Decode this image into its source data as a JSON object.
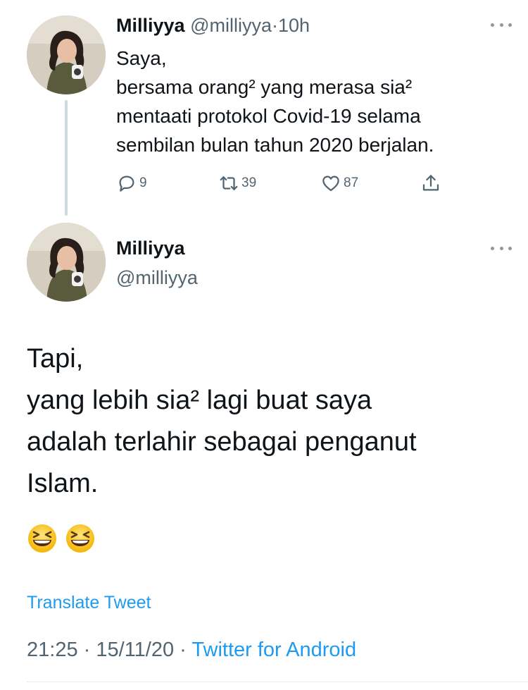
{
  "tweet1": {
    "name": "Milliyya",
    "handle": "@milliyya",
    "separator": "·",
    "time": "10h",
    "lines": [
      "Saya,",
      "bersama orang² yang merasa sia²",
      "mentaati protokol Covid-19 selama",
      "sembilan bulan tahun 2020 berjalan."
    ],
    "actions": {
      "reply_count": "9",
      "retweet_count": "39",
      "like_count": "87"
    }
  },
  "tweet2": {
    "name": "Milliyya",
    "handle": "@milliyya",
    "lines": [
      "Tapi,",
      "yang lebih sia² lagi buat saya",
      "adalah terlahir sebagai penganut",
      "Islam."
    ],
    "emojis": [
      "grinning-squinting-face",
      "grinning-squinting-face"
    ],
    "translate_label": "Translate Tweet",
    "time": "21:25",
    "date": "15/11/20",
    "separator": "·",
    "source": "Twitter for Android"
  },
  "colors": {
    "accent": "#1d9bf0",
    "secondary_text": "#536471",
    "primary_text": "#0f1419",
    "thread_line": "#cfd9de"
  },
  "icons": [
    "chat-bubble-icon",
    "retweet-icon",
    "heart-icon",
    "share-icon",
    "more-icon"
  ]
}
